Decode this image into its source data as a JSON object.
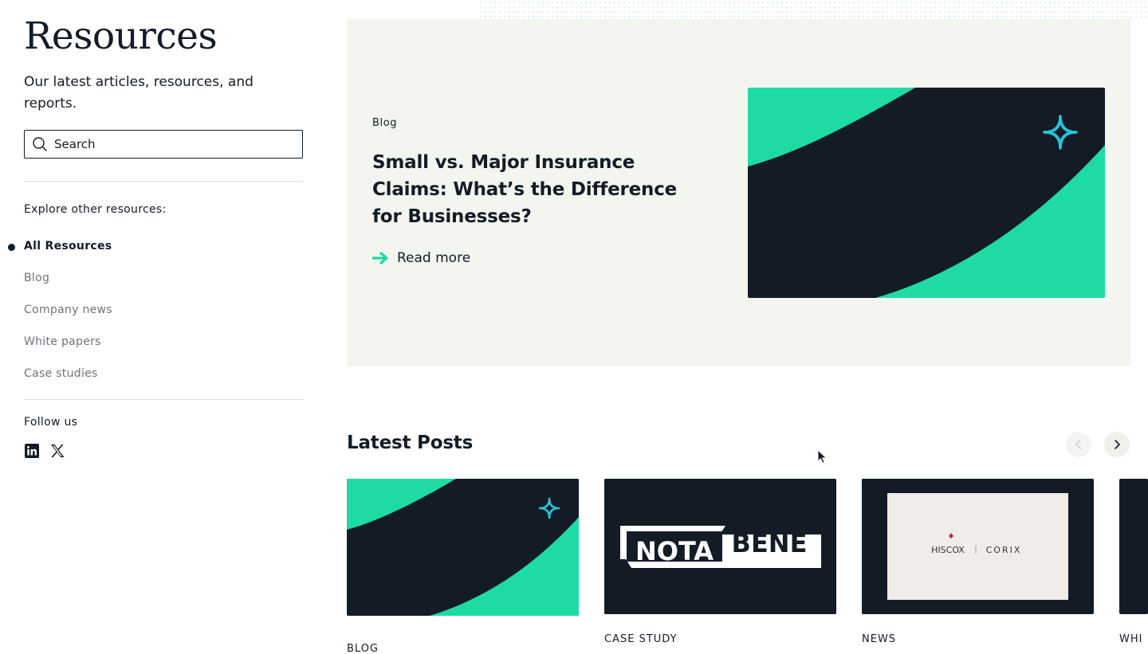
{
  "sidebar": {
    "title": "Resources",
    "subtitle": "Our latest articles, resources, and reports.",
    "search_placeholder": "Search",
    "explore_heading": "Explore other resources:",
    "nav": [
      {
        "label": "All Resources",
        "active": true
      },
      {
        "label": "Blog",
        "active": false
      },
      {
        "label": "Company news",
        "active": false
      },
      {
        "label": "White papers",
        "active": false
      },
      {
        "label": "Case studies",
        "active": false
      }
    ],
    "follow_heading": "Follow us",
    "social_icons": [
      "linkedin-icon",
      "x-icon"
    ]
  },
  "featured": {
    "tag": "Blog",
    "title": "Small vs. Major Insurance Claims: What’s the Difference for Businesses?",
    "cta": "Read more"
  },
  "latest": {
    "title": "Latest Posts",
    "cards": [
      {
        "tag": "BLOG",
        "image": "brand-curve-sparkle"
      },
      {
        "tag": "CASE STUDY",
        "image": "nota-bene-logo",
        "logo_text": [
          "NOTA",
          "BENE"
        ]
      },
      {
        "tag": "NEWS",
        "image": "hiscox-corix-logo",
        "logo_text": [
          "HISCOX",
          "CORIX"
        ]
      },
      {
        "tag": "WHI",
        "image": "partial-card"
      }
    ]
  },
  "colors": {
    "accent": "#1edba6",
    "dark": "#131c26",
    "featured_bg": "#f3f6ef",
    "sparkle": "#26c6da",
    "muted_nav": "#6e737a"
  }
}
